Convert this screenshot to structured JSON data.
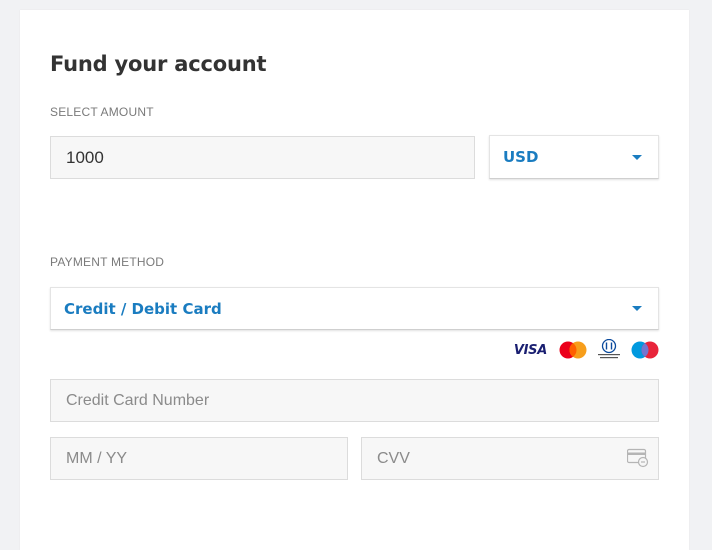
{
  "page": {
    "title": "Fund your account"
  },
  "amount": {
    "label": "SELECT AMOUNT",
    "value": "1000",
    "currency": {
      "selected": "USD"
    }
  },
  "payment": {
    "label": "PAYMENT METHOD",
    "method": {
      "selected": "Credit / Debit Card"
    },
    "card_logos": [
      "visa-icon",
      "mastercard-icon",
      "diners-club-icon",
      "maestro-icon"
    ],
    "visa_text": "VISA",
    "card_number": {
      "placeholder": "Credit Card Number",
      "value": ""
    },
    "expiry": {
      "placeholder": "MM / YY",
      "value": ""
    },
    "cvv": {
      "placeholder": "CVV",
      "value": ""
    }
  },
  "colors": {
    "accent": "#1a7cc0",
    "title": "#333333",
    "label": "#7a7a7a",
    "field_bg": "#f7f7f7",
    "page_bg": "#f1f2f4"
  }
}
